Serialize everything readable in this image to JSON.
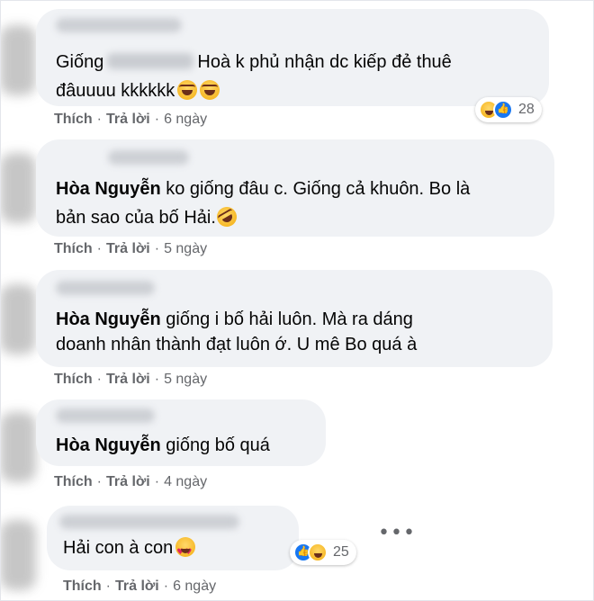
{
  "comments": [
    {
      "text_before": "Giống",
      "text_after": "Hoà k phủ nhận dc kiếp đẻ thuê",
      "line2": "đâuuuu kkkkkk",
      "emojis": [
        "laughing-face",
        "laughing-face"
      ],
      "actions": {
        "like": "Thích",
        "reply": "Trả lời",
        "time": "6 ngày"
      },
      "reaction": {
        "icons": [
          "haha",
          "like"
        ],
        "count": "28"
      }
    },
    {
      "name": "Hòa Nguyễn",
      "line1": "ko giống đâu c. Giống cả khuôn. Bo là",
      "line2": "bản sao của bố Hải.",
      "emojis": [
        "rofl-face"
      ],
      "actions": {
        "like": "Thích",
        "reply": "Trả lời",
        "time": "5 ngày"
      }
    },
    {
      "name": "Hòa Nguyễn",
      "line1": "giống i bố hải luôn. Mà ra dáng",
      "line2": "doanh nhân thành đạt luôn ớ. U mê Bo quá à",
      "actions": {
        "like": "Thích",
        "reply": "Trả lời",
        "time": "5 ngày"
      }
    },
    {
      "name": "Hòa Nguyễn",
      "line1": "giống bố quá",
      "actions": {
        "like": "Thích",
        "reply": "Trả lời",
        "time": "4 ngày"
      }
    },
    {
      "line1": "Hải con à con",
      "emojis": [
        "heart-eyes-face"
      ],
      "actions": {
        "like": "Thích",
        "reply": "Trả lời",
        "time": "6 ngày"
      },
      "reaction": {
        "icons": [
          "like",
          "haha"
        ],
        "count": "25"
      },
      "more": "•••"
    }
  ],
  "colors": {
    "bubble": "#f0f2f5",
    "meta_text": "#65676b",
    "like_blue": "#1877f2",
    "emoji_yellow": "#f7b928"
  }
}
